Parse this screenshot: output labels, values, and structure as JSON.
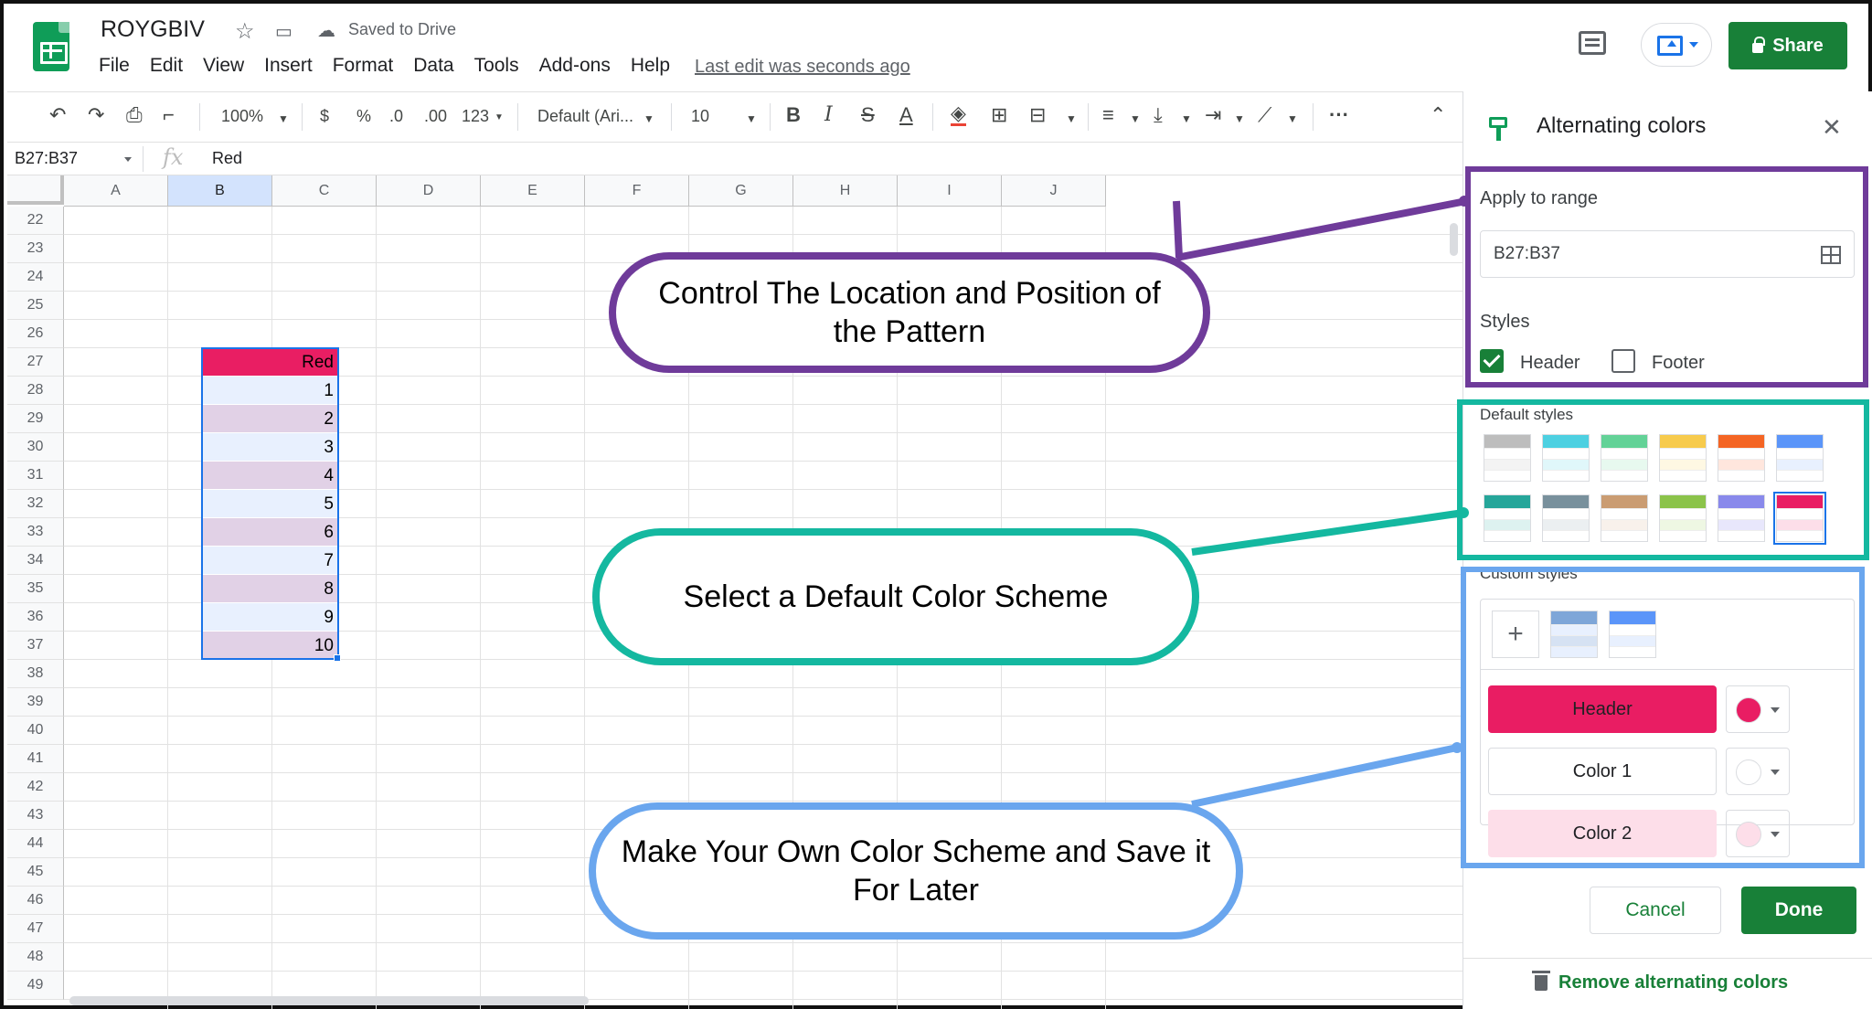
{
  "app": {
    "doc_title": "ROYGBIV",
    "saved_status": "Saved to Drive",
    "last_edit": "Last edit was seconds ago",
    "share_label": "Share",
    "menu": [
      "File",
      "Edit",
      "View",
      "Insert",
      "Format",
      "Data",
      "Tools",
      "Add-ons",
      "Help"
    ]
  },
  "toolbar": {
    "zoom": "100%",
    "currency": "$",
    "percent": "%",
    "dec_decrease": ".0",
    "dec_increase": ".00",
    "more_formats": "123",
    "font": "Default (Ari...",
    "font_size": "10",
    "bold": "B",
    "italic": "I",
    "strike": "S",
    "text_color": "A",
    "more": "···"
  },
  "formula_bar": {
    "name_box": "B27:B37",
    "fx": "fx",
    "value": "Red"
  },
  "sheet": {
    "columns": [
      "A",
      "B",
      "C",
      "D",
      "E",
      "F",
      "G",
      "H",
      "I",
      "J"
    ],
    "selected_column": "B",
    "rows": [
      "22",
      "23",
      "24",
      "25",
      "26",
      "27",
      "28",
      "29",
      "30",
      "31",
      "32",
      "33",
      "34",
      "35",
      "36",
      "37",
      "38",
      "39",
      "40",
      "41",
      "42",
      "43",
      "44",
      "45",
      "46",
      "47",
      "48",
      "49"
    ],
    "cells_b": [
      {
        "row": "27",
        "value": "Red",
        "fill": "#e91e63"
      },
      {
        "row": "28",
        "value": "1",
        "fill": "#e8f0fe"
      },
      {
        "row": "29",
        "value": "2",
        "fill": "#e1d1e6"
      },
      {
        "row": "30",
        "value": "3",
        "fill": "#e8f0fe"
      },
      {
        "row": "31",
        "value": "4",
        "fill": "#e1d1e6"
      },
      {
        "row": "32",
        "value": "5",
        "fill": "#e8f0fe"
      },
      {
        "row": "33",
        "value": "6",
        "fill": "#e1d1e6"
      },
      {
        "row": "34",
        "value": "7",
        "fill": "#e8f0fe"
      },
      {
        "row": "35",
        "value": "8",
        "fill": "#e1d1e6"
      },
      {
        "row": "36",
        "value": "9",
        "fill": "#e8f0fe"
      },
      {
        "row": "37",
        "value": "10",
        "fill": "#e1d1e6"
      }
    ]
  },
  "panel": {
    "title": "Alternating colors",
    "apply_label": "Apply to range",
    "range_value": "B27:B37",
    "styles_label": "Styles",
    "header_label": "Header",
    "header_checked": true,
    "footer_label": "Footer",
    "footer_checked": false,
    "default_styles_label": "Default styles",
    "default_styles": [
      {
        "header": "#bdbdbd",
        "c1": "#ffffff",
        "c2": "#f3f3f3"
      },
      {
        "header": "#4dd0e1",
        "c1": "#ffffff",
        "c2": "#e0f7fa"
      },
      {
        "header": "#63d297",
        "c1": "#ffffff",
        "c2": "#e7f9ef"
      },
      {
        "header": "#f7cb4d",
        "c1": "#ffffff",
        "c2": "#fef8e3"
      },
      {
        "header": "#f46524",
        "c1": "#ffffff",
        "c2": "#ffe6dd"
      },
      {
        "header": "#5b95f9",
        "c1": "#ffffff",
        "c2": "#e8f0fe"
      },
      {
        "header": "#26a69a",
        "c1": "#ffffff",
        "c2": "#ddf2f0"
      },
      {
        "header": "#78909c",
        "c1": "#ffffff",
        "c2": "#ebeff1"
      },
      {
        "header": "#ca9c72",
        "c1": "#ffffff",
        "c2": "#f8f1eb"
      },
      {
        "header": "#8bc34a",
        "c1": "#ffffff",
        "c2": "#eef7e3"
      },
      {
        "header": "#8989eb",
        "c1": "#ffffff",
        "c2": "#e8e7fc"
      },
      {
        "header": "#e91d63",
        "c1": "#ffffff",
        "c2": "#fddee9"
      }
    ],
    "selected_default_index": 11,
    "custom_styles_label": "Custom styles",
    "add_label": "+",
    "custom_styles": [
      {
        "header": "#7ea6d8",
        "c1": "#e8f0fe",
        "c2": "#d6e2f3"
      },
      {
        "header": "#5b95f9",
        "c1": "#ffffff",
        "c2": "#e8f0fe"
      }
    ],
    "color_rows": [
      {
        "label": "Header",
        "color": "#e91d63",
        "text_color": "#202124"
      },
      {
        "label": "Color 1",
        "color": "#ffffff",
        "text_color": "#202124"
      },
      {
        "label": "Color 2",
        "color": "#fddee9",
        "text_color": "#202124"
      }
    ],
    "cancel_label": "Cancel",
    "done_label": "Done",
    "remove_label": "Remove alternating colors"
  },
  "annotations": {
    "range_callout": "Control The Location and Position of the Pattern",
    "default_callout": "Select a Default Color Scheme",
    "custom_callout": "Make Your Own Color Scheme and Save it For Later",
    "colors": {
      "purple": "#6f3b9a",
      "teal": "#14b8a0",
      "blue": "#6aa6ee"
    }
  }
}
